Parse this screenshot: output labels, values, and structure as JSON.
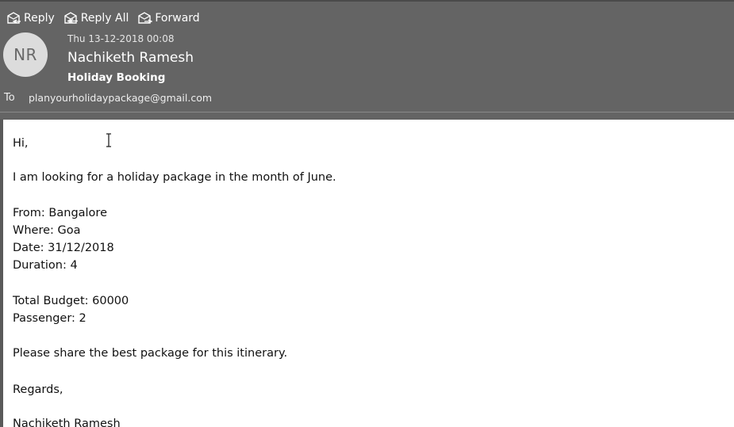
{
  "actions": [
    {
      "label": "Reply",
      "icon": "reply-icon"
    },
    {
      "label": "Reply All",
      "icon": "reply-all-icon"
    },
    {
      "label": "Forward",
      "icon": "forward-icon"
    }
  ],
  "message": {
    "avatar_initials": "NR",
    "date": "Thu 13-12-2018 00:08",
    "sender": "Nachiketh Ramesh",
    "subject": "Holiday Booking",
    "to_label": "To",
    "to_value": "planyourholidaypackage@gmail.com"
  },
  "body": {
    "greeting": "Hi,",
    "intro": "I am looking for a holiday package in the month of June.",
    "from": "From: Bangalore",
    "where": "Where: Goa",
    "date": "Date: 31/12/2018",
    "duration": "Duration: 4",
    "budget": "Total Budget: 60000",
    "passenger": "Passenger: 2",
    "request": "Please share the best package for this itinerary.",
    "closing": "Regards,",
    "signature": "Nachiketh Ramesh"
  },
  "colors": {
    "header_bg": "#646464",
    "body_bg": "#ffffff",
    "avatar_bg": "#dcdcdc"
  }
}
